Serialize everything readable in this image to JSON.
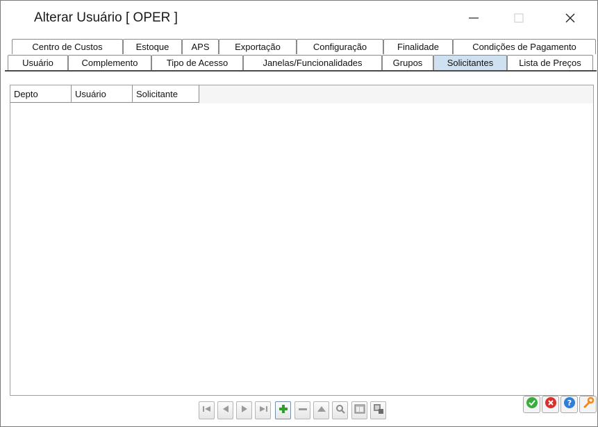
{
  "window": {
    "title": "Alterar Usuário [ OPER ]",
    "controls": [
      "minimize-icon",
      "maximize-icon",
      "close-icon"
    ]
  },
  "tabs": {
    "row1": [
      {
        "label": "Centro de Custos"
      },
      {
        "label": "Estoque"
      },
      {
        "label": "APS"
      },
      {
        "label": "Exportação"
      },
      {
        "label": "Configuração"
      },
      {
        "label": "Finalidade"
      },
      {
        "label": "Condições de Pagamento"
      }
    ],
    "row2": [
      {
        "label": "Usuário"
      },
      {
        "label": "Complemento"
      },
      {
        "label": "Tipo de Acesso"
      },
      {
        "label": "Janelas/Funcionalidades"
      },
      {
        "label": "Grupos"
      },
      {
        "label": "Solicitantes",
        "active": true
      },
      {
        "label": "Lista de Preços"
      }
    ],
    "active_color": "#cfe0f1"
  },
  "grid": {
    "columns": [
      {
        "label": "Depto"
      },
      {
        "label": "Usuário"
      },
      {
        "label": "Solicitante"
      }
    ],
    "rows": []
  },
  "navigator": {
    "buttons": [
      "first-record-icon",
      "prior-record-icon",
      "next-record-icon",
      "last-record-icon",
      "insert-record-icon",
      "delete-record-icon",
      "edit-record-icon",
      "search-icon",
      "grid-view-icon",
      "export-icon"
    ]
  },
  "actions": {
    "buttons": [
      "confirm-icon",
      "cancel-icon",
      "help-icon",
      "settings-wrench-icon"
    ],
    "colors": {
      "confirm": "#3bab3b",
      "cancel": "#d9302c",
      "help": "#2f7fd6",
      "settings": "#f08a1c"
    }
  }
}
